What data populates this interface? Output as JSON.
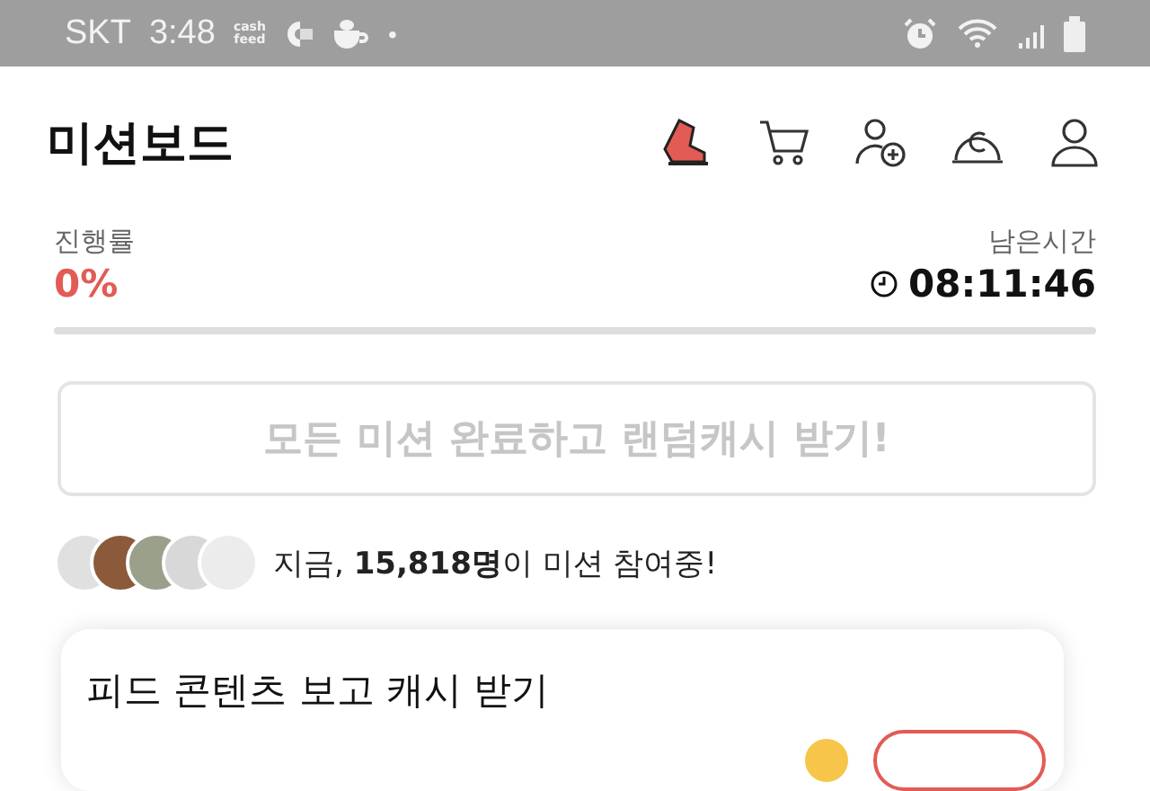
{
  "status_bar": {
    "carrier": "SKT",
    "time": "3:48",
    "app_label_lines": [
      "cash",
      "feed"
    ],
    "dot": "•"
  },
  "header": {
    "title": "미션보드"
  },
  "progress": {
    "label": "진행률",
    "value": "0%",
    "remaining_label": "남은시간",
    "remaining": "08:11:46"
  },
  "complete_button": {
    "label": "모든 미션 완료하고 랜덤캐시 받기!",
    "disabled": true
  },
  "participants": {
    "text": "지금, **15,818명**이 미션 참여중!"
  },
  "card": {
    "title": "피드 콘텐츠 보고 캐시 받기"
  }
}
